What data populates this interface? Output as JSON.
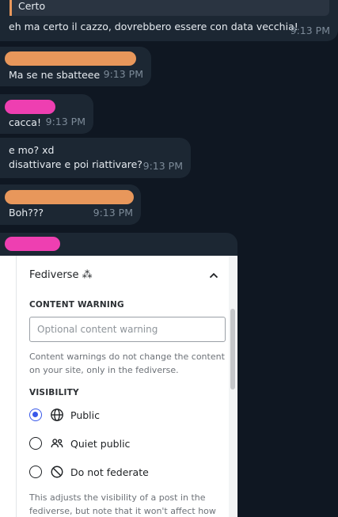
{
  "messages": [
    {
      "quote": "Certo",
      "text": "eh ma certo il cazzo, dovrebbero essere con data vecchia!",
      "time": "9:13 PM"
    },
    {
      "text": "Ma se ne sbatteee",
      "time": "9:13 PM"
    },
    {
      "text": "cacca!",
      "time": "9:13 PM"
    },
    {
      "text_line1": "e mo? xd",
      "text_line2": "disattivare e poi riattivare?",
      "time": "9:13 PM"
    },
    {
      "text": "Boh???",
      "time": "9:13 PM"
    }
  ],
  "panel": {
    "title": "Fediverse ⁂",
    "content_warning_label": "CONTENT WARNING",
    "content_warning_placeholder": "Optional content warning",
    "content_warning_value": "",
    "content_warning_help_1": "Content warnings do not change the content",
    "content_warning_help_2": "on your site, only in the fediverse.",
    "visibility_label": "VISIBILITY",
    "options": [
      {
        "label": "Public",
        "icon": "globe-icon",
        "selected": true
      },
      {
        "label": "Quiet public",
        "icon": "people-icon",
        "selected": false
      },
      {
        "label": "Do not federate",
        "icon": "block-icon",
        "selected": false
      }
    ],
    "visibility_help_1": "This adjusts the visibility of a post in the",
    "visibility_help_2": "fediverse, but note that it won't affect how"
  },
  "colors": {
    "background": "#0f1722",
    "bubble": "#1c2733",
    "sender_orange": "#e8975b",
    "sender_pink": "#ee3fb1",
    "accent": "#3858e9"
  }
}
